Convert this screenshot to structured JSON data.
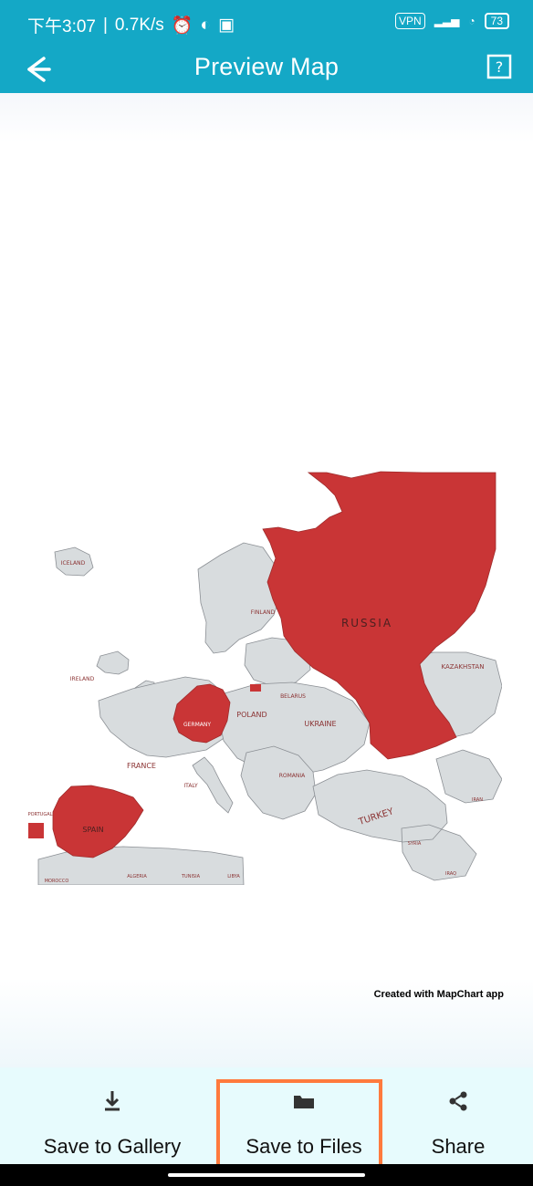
{
  "status_bar": {
    "time": "下午3:07",
    "network_speed": "0.7K/s",
    "vpn_label": "VPN",
    "battery": "73"
  },
  "app_bar": {
    "title": "Preview Map"
  },
  "map": {
    "highlight_color": "#cc3333",
    "base_color": "#d8dcde",
    "labels": {
      "russia": "RUSSIA",
      "kazakhstan": "KAZAKHSTAN",
      "finland": "FINLAND",
      "iceland": "ICELAND",
      "ireland": "IRELAND",
      "germany": "GERMANY",
      "poland": "POLAND",
      "belarus": "BELARUS",
      "ukraine": "UKRAINE",
      "france": "FRANCE",
      "italy": "ITALY",
      "romania": "ROMANIA",
      "spain": "SPAIN",
      "portugal": "PORTUGAL",
      "turkey": "TURKEY",
      "syria": "SYRIA",
      "iraq": "IRAQ",
      "iran": "IRAN",
      "morocco": "MOROCCO",
      "algeria": "ALGERIA",
      "tunisia": "TUNISIA",
      "libya": "LIBYA"
    },
    "credit": "Created with MapChart app"
  },
  "actions": {
    "gallery": "Save to Gallery",
    "files": "Save to Files",
    "share": "Share"
  },
  "accent_colors": {
    "app_bar": "#14a8c6",
    "bottom_bar": "#e7fbfd",
    "highlight": "#ff7a3d"
  }
}
